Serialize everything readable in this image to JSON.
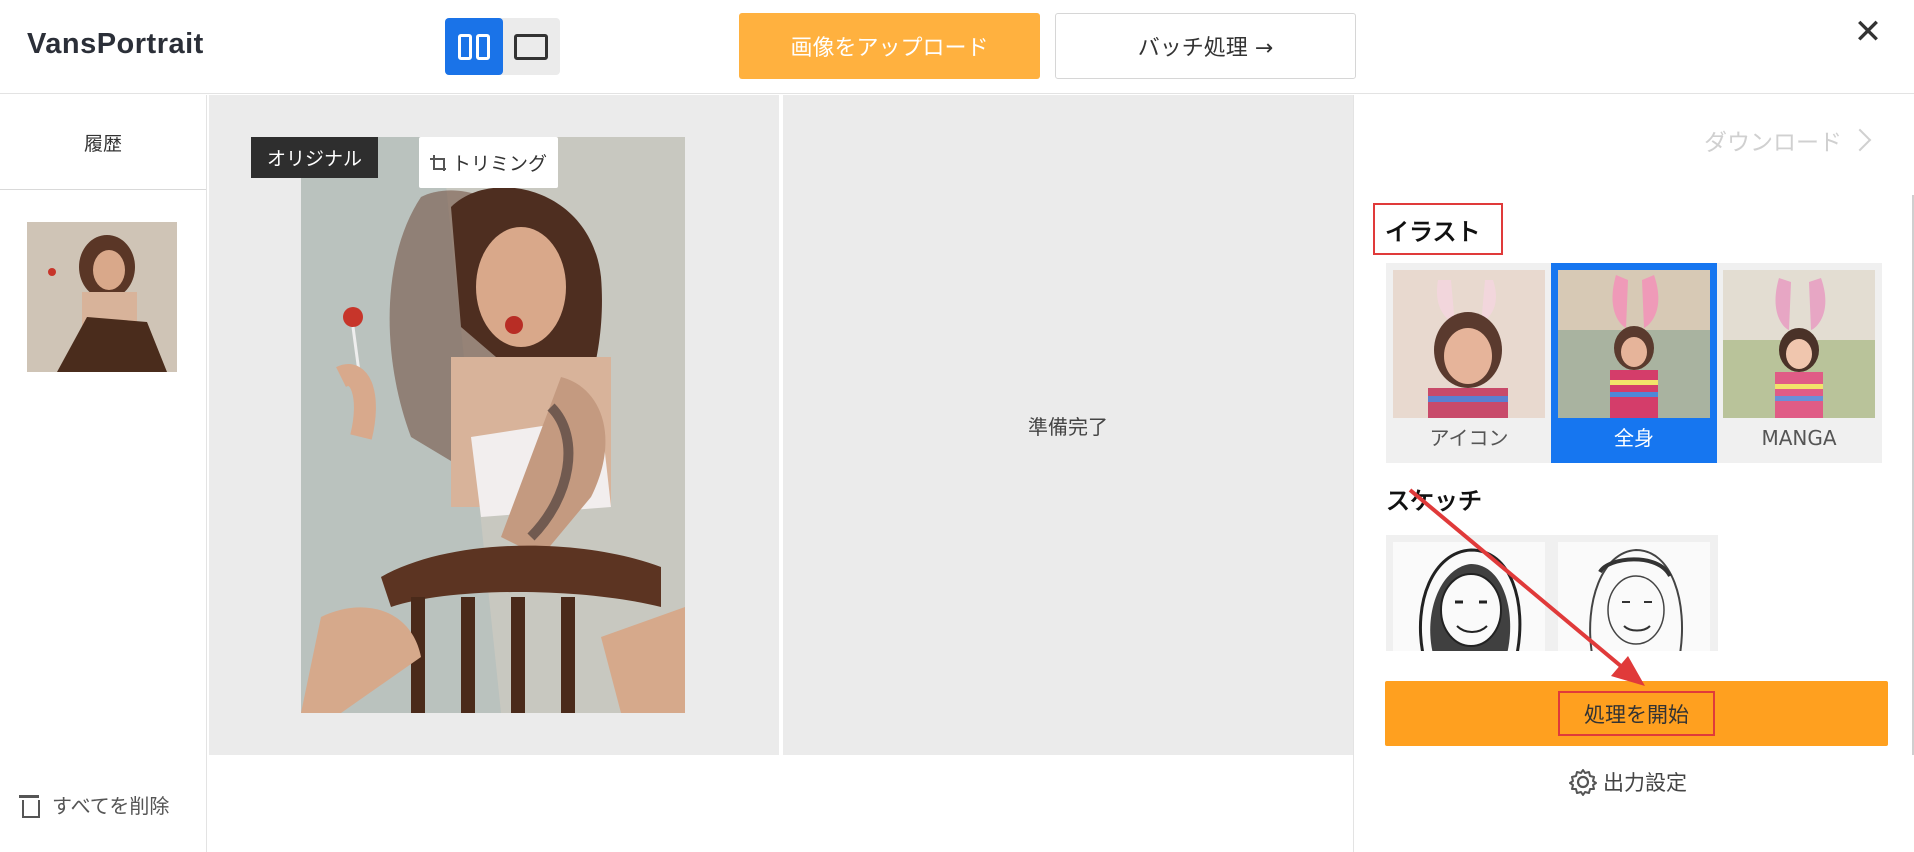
{
  "header": {
    "brand": "VansPortrait",
    "upload_label": "画像をアップロード",
    "batch_label": "バッチ処理 →",
    "close_glyph": "✕"
  },
  "sidebar": {
    "history_label": "履歴",
    "delete_all_label": "すべてを削除"
  },
  "preview": {
    "original_tag": "オリジナル",
    "trim_label": "トリミング",
    "ready_text": "準備完了"
  },
  "right_panel": {
    "download_label": "ダウンロード",
    "illust_title": "イラスト",
    "sketch_title": "スケッチ",
    "styles": [
      {
        "label": "アイコン",
        "selected": false
      },
      {
        "label": "全身",
        "selected": true
      },
      {
        "label": "MANGA",
        "selected": false
      }
    ],
    "start_label": "処理を開始",
    "output_settings_label": "出力設定"
  },
  "colors": {
    "accent_orange": "#ffb13f",
    "start_orange": "#ffa01f",
    "selected_blue": "#1676f0",
    "annotation_red": "#e03a3a"
  }
}
